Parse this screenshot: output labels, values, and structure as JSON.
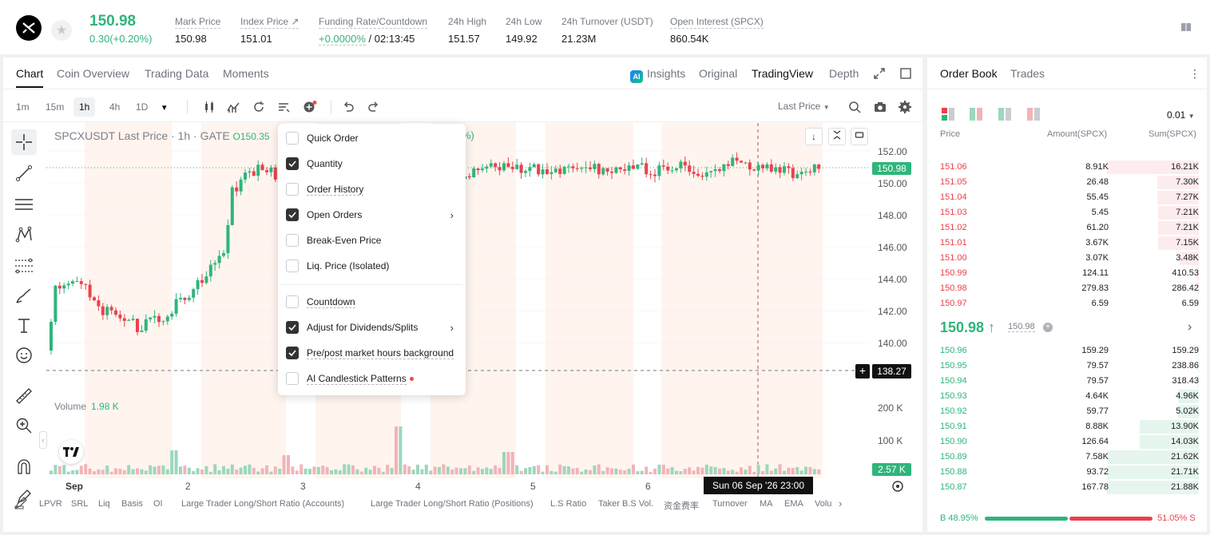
{
  "ticker": {
    "price": "150.98",
    "change": "0.30(+0.20%)",
    "stats": [
      {
        "label": "Mark Price",
        "value": "150.98"
      },
      {
        "label": "Index Price ↗",
        "value": "151.01"
      },
      {
        "label": "Funding Rate/Countdown",
        "value_green": "+0.0000%",
        "value": " / 02:13:45"
      },
      {
        "label": "24h High",
        "value": "151.57"
      },
      {
        "label": "24h Low",
        "value": "149.92"
      },
      {
        "label": "24h Turnover (USDT)",
        "value": "21.23M"
      },
      {
        "label": "Open Interest (SPCX)",
        "value": "860.54K"
      }
    ]
  },
  "chart_tabs": [
    "Chart",
    "Coin Overview",
    "Trading Data",
    "Moments"
  ],
  "view_tabs": {
    "insights": "Insights",
    "original": "Original",
    "tradingview": "TradingView",
    "depth": "Depth"
  },
  "timeframes": [
    "1m",
    "15m",
    "1h",
    "4h",
    "1D"
  ],
  "last_price_select": "Last Price",
  "chart_title": {
    "text": "SPCXUSDT Last Price · 1h · GATE",
    "ohlc": "O150.35",
    "tail": "%)"
  },
  "volume_label": {
    "text": "Volume",
    "value": "1.98 K"
  },
  "y_labels": [
    "152.00",
    "150.00",
    "148.00",
    "146.00",
    "144.00",
    "142.00",
    "140.00"
  ],
  "vol_y_labels": [
    "200 K",
    "100 K"
  ],
  "price_tag": "150.98",
  "cross_tag": "138.27",
  "vol_tag": "2.57 K",
  "x_labels": [
    "Sep",
    "2",
    "3",
    "4",
    "5",
    "6"
  ],
  "crosshair_date": "Sun 06 Sep '26   23:00",
  "menu": {
    "items": [
      {
        "label": "Quick Order",
        "checked": false
      },
      {
        "label": "Quantity",
        "checked": true
      },
      {
        "label": "Order History",
        "checked": false
      },
      {
        "label": "Open Orders",
        "checked": true
      },
      {
        "label": "Break-Even Price",
        "checked": false
      },
      {
        "label": "Liq. Price (Isolated)",
        "checked": false
      },
      {
        "label": "Countdown",
        "checked": false
      },
      {
        "label": "Adjust for Dividends/Splits",
        "checked": true
      },
      {
        "label": "Pre/post market hours background",
        "checked": true
      },
      {
        "label": "AI Candlestick Patterns",
        "checked": false
      }
    ]
  },
  "bottom_indicators": [
    "LPVR",
    "SRL",
    "Liq",
    "Basis",
    "OI",
    "Large Trader Long/Short Ratio (Accounts)",
    "Large Trader Long/Short Ratio (Positions)",
    "L.S Ratio",
    "Taker B.S Vol.",
    "资金费率",
    "Turnover",
    "MA",
    "EMA",
    "Volu"
  ],
  "orderbook": {
    "tabs": [
      "Order Book",
      "Trades"
    ],
    "precision": "0.01",
    "columns": [
      "Price",
      "Amount(SPCX)",
      "Sum(SPCX)"
    ],
    "asks": [
      {
        "price": "151.06",
        "amount": "8.91K",
        "sum": "16.21K",
        "depth": 1.0
      },
      {
        "price": "151.05",
        "amount": "26.48",
        "sum": "7.30K",
        "depth": 0.45
      },
      {
        "price": "151.04",
        "amount": "55.45",
        "sum": "7.27K",
        "depth": 0.45
      },
      {
        "price": "151.03",
        "amount": "5.45",
        "sum": "7.21K",
        "depth": 0.44
      },
      {
        "price": "151.02",
        "amount": "61.20",
        "sum": "7.21K",
        "depth": 0.44
      },
      {
        "price": "151.01",
        "amount": "3.67K",
        "sum": "7.15K",
        "depth": 0.44
      },
      {
        "price": "151.00",
        "amount": "3.07K",
        "sum": "3.48K",
        "depth": 0.21
      },
      {
        "price": "150.99",
        "amount": "124.11",
        "sum": "410.53",
        "depth": 0.03
      },
      {
        "price": "150.98",
        "amount": "279.83",
        "sum": "286.42",
        "depth": 0.02
      },
      {
        "price": "150.97",
        "amount": "6.59",
        "sum": "6.59",
        "depth": 0.0
      }
    ],
    "mid_price": "150.98 ↑",
    "mark": "150.98",
    "bids": [
      {
        "price": "150.96",
        "amount": "159.29",
        "sum": "159.29",
        "depth": 0.01
      },
      {
        "price": "150.95",
        "amount": "79.57",
        "sum": "238.86",
        "depth": 0.01
      },
      {
        "price": "150.94",
        "amount": "79.57",
        "sum": "318.43",
        "depth": 0.01
      },
      {
        "price": "150.93",
        "amount": "4.64K",
        "sum": "4.96K",
        "depth": 0.23
      },
      {
        "price": "150.92",
        "amount": "59.77",
        "sum": "5.02K",
        "depth": 0.23
      },
      {
        "price": "150.91",
        "amount": "8.88K",
        "sum": "13.90K",
        "depth": 0.64
      },
      {
        "price": "150.90",
        "amount": "126.64",
        "sum": "14.03K",
        "depth": 0.64
      },
      {
        "price": "150.89",
        "amount": "7.58K",
        "sum": "21.62K",
        "depth": 0.99
      },
      {
        "price": "150.88",
        "amount": "93.72",
        "sum": "21.71K",
        "depth": 0.99
      },
      {
        "price": "150.87",
        "amount": "167.78",
        "sum": "21.88K",
        "depth": 1.0
      }
    ],
    "buy_ratio": "B 48.95%",
    "sell_ratio": "51.05% S"
  },
  "colors": {
    "up": "#2fb57b",
    "down": "#e9424d"
  }
}
